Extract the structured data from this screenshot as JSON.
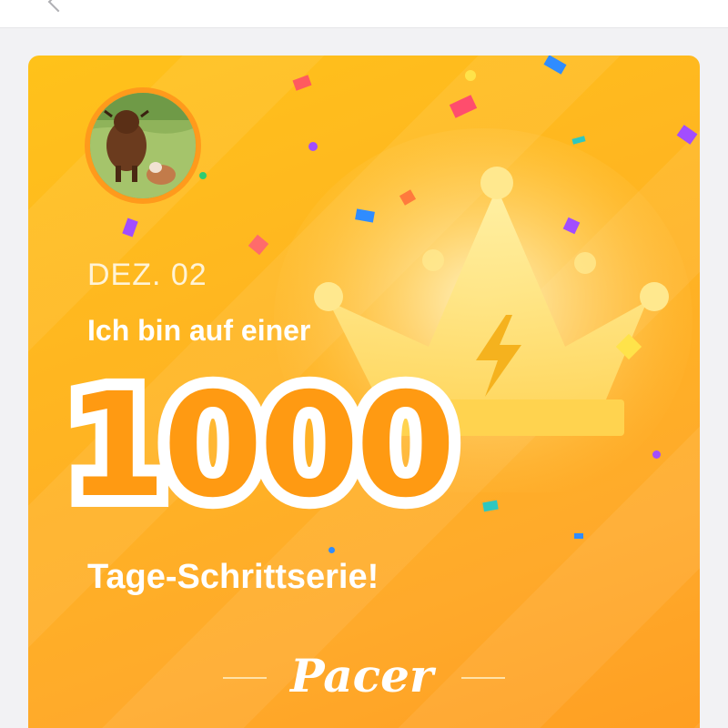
{
  "card": {
    "date": "DEZ. 02",
    "headline": "Ich bin auf einer",
    "streak_number": "1000",
    "subline": "Tage-Schrittserie!",
    "brand": "Pacer"
  },
  "icons": {
    "top_left": "back-arrow-icon",
    "crown": "crown-icon",
    "bolt": "lightning-bolt-icon"
  },
  "colors": {
    "card_orange": "#ffb521",
    "number_orange": "#ff9a12",
    "crown_yellow": "#ffe17a",
    "bolt_orange": "#f5b21e"
  }
}
